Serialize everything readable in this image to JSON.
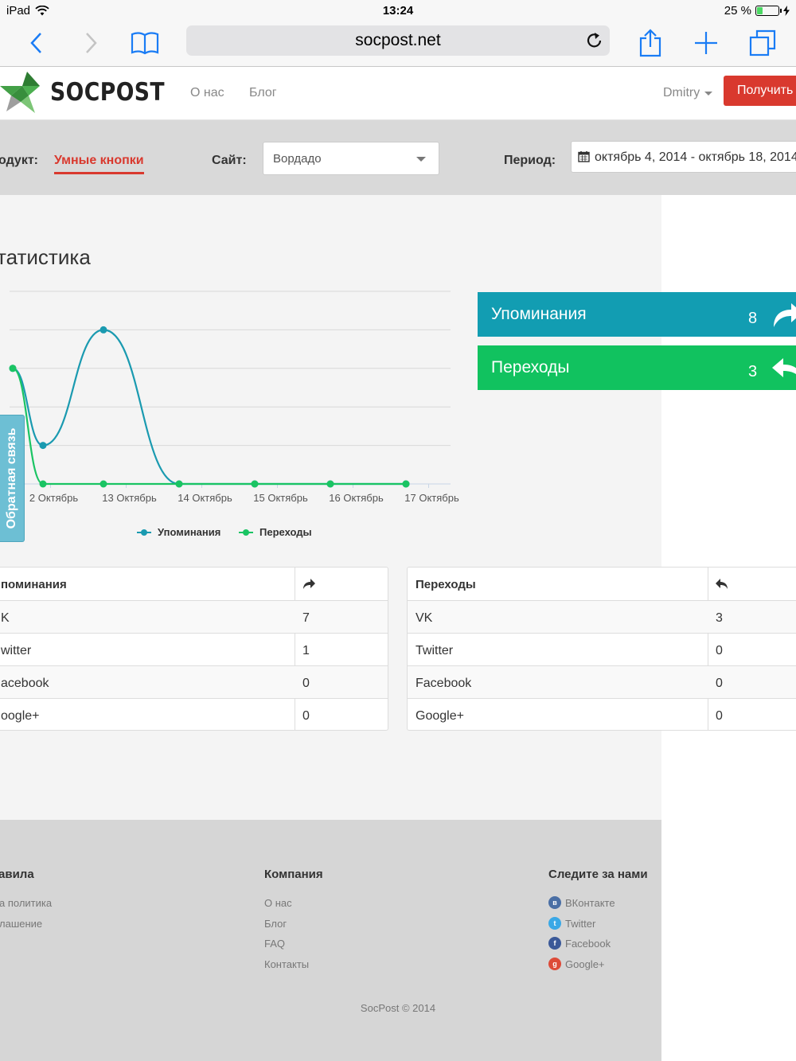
{
  "statusbar": {
    "device": "iPad",
    "time": "13:24",
    "battery": "25 %",
    "battery_level": 0.25
  },
  "browser": {
    "url": "socpost.net"
  },
  "header": {
    "logo": "SOCPOST",
    "nav": [
      "О нас",
      "Блог"
    ],
    "user": "Dmitry",
    "get_button": "Получить"
  },
  "filters": {
    "product_label": "одукт:",
    "product_value": "Умные кнопки",
    "site_label": "Сайт:",
    "site_value": "Вордадо",
    "period_label": "Период:",
    "period_value": "октябрь 4, 2014 - октябрь 18, 2014"
  },
  "main": {
    "title": "татистика"
  },
  "feedback": "Обратная связь",
  "chart_data": {
    "type": "line",
    "categories": [
      "",
      "2 Октябрь",
      "",
      "13 Октябрь",
      "",
      "14 Октябрь",
      "",
      "15 Октябрь",
      "",
      "16 Октябрь",
      "",
      "17 Октябрь"
    ],
    "x_tick_labels": [
      "2 Октябрь",
      "13 Октябрь",
      "14 Октябрь",
      "15 Октябрь",
      "16 Октябрь",
      "17 Октябрь"
    ],
    "series": [
      {
        "name": "Упоминания",
        "color": "#1a9ab0",
        "values": [
          3,
          1,
          4,
          0,
          0,
          0,
          0
        ]
      },
      {
        "name": "Переходы",
        "color": "#1ac463",
        "values": [
          3,
          0,
          0,
          0,
          0,
          0,
          0
        ]
      }
    ],
    "points_x_days": [
      11.5,
      11.9,
      12.7,
      13.7,
      14.7,
      15.7,
      16.7
    ],
    "ylim": [
      0,
      5
    ],
    "grid": true,
    "legend": "bottom"
  },
  "stats": [
    {
      "label": "Упоминания",
      "count": "8",
      "color": "#129db2",
      "icon": "share-forward-icon"
    },
    {
      "label": "Переходы",
      "count": "3",
      "color": "#11c25f",
      "icon": "reply-icon"
    }
  ],
  "table_mentions": {
    "header": "поминания",
    "icon": "share-forward-icon",
    "rows": [
      [
        "K",
        "7"
      ],
      [
        "witter",
        "1"
      ],
      [
        "acebook",
        "0"
      ],
      [
        "oogle+",
        "0"
      ]
    ]
  },
  "table_clicks": {
    "header": "Переходы",
    "icon": "reply-icon",
    "rows": [
      [
        "VK",
        "3"
      ],
      [
        "Twitter",
        "0"
      ],
      [
        "Facebook",
        "0"
      ],
      [
        "Google+",
        "0"
      ]
    ]
  },
  "footer": {
    "col1": {
      "title": "авила",
      "links": [
        "а политика",
        "лашение"
      ]
    },
    "col2": {
      "title": "Компания",
      "links": [
        "О нас",
        "Блог",
        "FAQ",
        "Контакты"
      ]
    },
    "col3": {
      "title": "Следите за нами",
      "links": [
        "ВКонтакте",
        "Twitter",
        "Facebook",
        "Google+"
      ],
      "icons": [
        "vk-icon",
        "twitter-icon",
        "facebook-icon",
        "google-plus-icon"
      ],
      "colors": [
        "#4a6fa5",
        "#3aa8e6",
        "#3b5998",
        "#dd4b39"
      ]
    },
    "copyright": "SocPost © 2014"
  }
}
